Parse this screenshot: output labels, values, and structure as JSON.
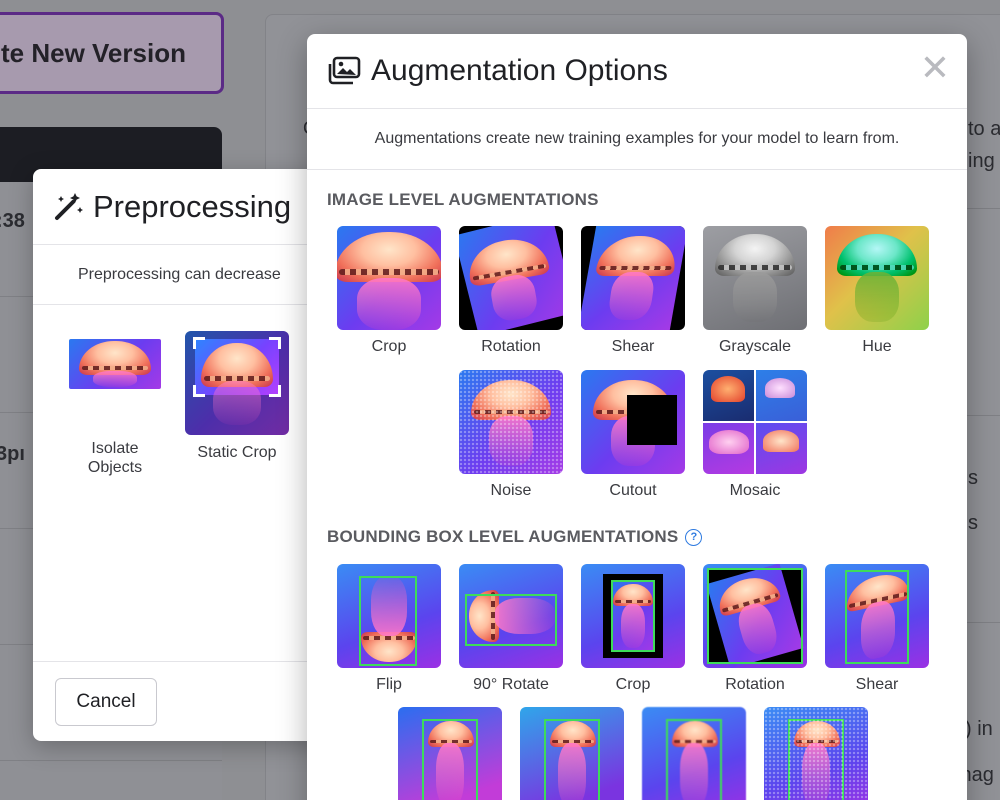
{
  "background": {
    "create_button_label": "te New Version",
    "frag_time1": ":38",
    "frag_time2": "3pı",
    "frag_right1": "to a",
    "frag_right2": "ing",
    "frag_right3": "s",
    "frag_right4": "s",
    "frag_right5": "s) in",
    "frag_right6": "mag",
    "frag_c": "C"
  },
  "preprocessing": {
    "title": "Preprocessing",
    "description": "Preprocessing can decrease",
    "options": [
      {
        "label": "Isolate Objects",
        "icon": "isolate-objects-thumbnail"
      },
      {
        "label": "Static Crop",
        "icon": "static-crop-thumbnail"
      }
    ],
    "cancel_label": "Cancel",
    "icon": "magic-wand-icon"
  },
  "augmentation": {
    "title": "Augmentation Options",
    "icon": "images-icon",
    "close_icon": "close-icon",
    "description": "Augmentations create new training examples for your model to learn from.",
    "image_level": {
      "heading": "IMAGE LEVEL AUGMENTATIONS",
      "items": [
        "Crop",
        "Rotation",
        "Shear",
        "Grayscale",
        "Hue",
        "Noise",
        "Cutout",
        "Mosaic"
      ]
    },
    "bbox_level": {
      "heading": "BOUNDING BOX LEVEL AUGMENTATIONS",
      "help_icon": "help-circle-icon",
      "items": [
        "Flip",
        "90° Rotate",
        "Crop",
        "Rotation",
        "Shear"
      ]
    }
  },
  "colors": {
    "overlay": "#8e8f93",
    "accent_purple": "#5b2a86",
    "help_blue": "#2f7be0",
    "bbox_green": "#3ddc5a"
  }
}
